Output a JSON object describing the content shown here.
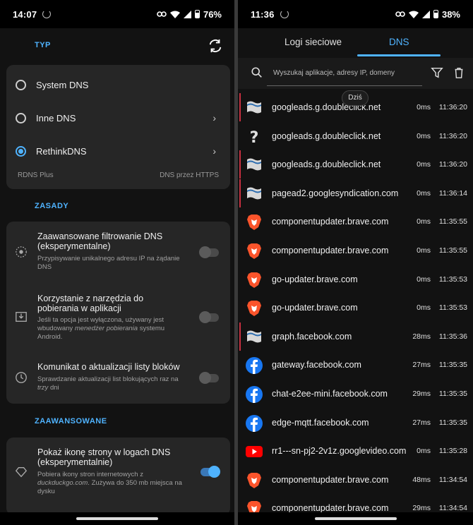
{
  "left": {
    "status": {
      "time": "14:07",
      "battery": "76%"
    },
    "section_type": "TYP",
    "dns_options": [
      {
        "label": "System DNS",
        "selected": false,
        "has_chevron": false
      },
      {
        "label": "Inne DNS",
        "selected": false,
        "has_chevron": true
      },
      {
        "label": "RethinkDNS",
        "selected": true,
        "has_chevron": true
      }
    ],
    "dns_footer_left": "RDNS Plus",
    "dns_footer_right": "DNS przez HTTPS",
    "section_rules": "ZASADY",
    "rules": [
      {
        "title": "Zaawansowane filtrowanie DNS (eksperymentalne)",
        "desc": "Przypisywanie unikalnego adresu IP na żądanie DNS",
        "icon": "target-icon",
        "on": false
      },
      {
        "title": "Korzystanie z narzędzia do pobierania w aplikacji",
        "desc_parts": [
          "Jeśli ta opcja jest wyłączona, używany jest wbudowany ",
          "menedżer pobierania",
          " systemu Android."
        ],
        "icon": "download-icon",
        "on": false
      },
      {
        "title": "Komunikat o aktualizacji listy bloków",
        "desc_parts": [
          "Sprawdzanie aktualizacji list blokujących raz na ",
          "trzy",
          " dni"
        ],
        "icon": "clock-icon",
        "on": false
      }
    ],
    "section_advanced": "ZAAWANSOWANE",
    "advanced": [
      {
        "title": "Pokaż ikonę strony w logach DNS (eksperymentalnie)",
        "desc_parts": [
          "Pobiera ikony stron internetowych z ",
          "duckduckgo.com",
          ". Zużywa do 350 mb miejsca na dysku"
        ],
        "icon": "tag-icon",
        "on": true
      }
    ]
  },
  "right": {
    "status": {
      "time": "11:36",
      "battery": "38%"
    },
    "tabs": [
      "Logi sieciowe",
      "DNS"
    ],
    "active_tab": 1,
    "search_placeholder": "Wyszukaj aplikacje, adresy IP, domeny",
    "today_label": "Dziś",
    "logs": [
      {
        "domain": "googleads.g.doubleclick.net",
        "ms": "0ms",
        "time": "11:36:20",
        "icon": "flag-icon",
        "blocked": true
      },
      {
        "domain": "googleads.g.doubleclick.net",
        "ms": "0ms",
        "time": "11:36:20",
        "icon": "question-icon",
        "blocked": false
      },
      {
        "domain": "googleads.g.doubleclick.net",
        "ms": "0ms",
        "time": "11:36:20",
        "icon": "flag-icon",
        "blocked": true
      },
      {
        "domain": "pagead2.googlesyndication.com",
        "ms": "0ms",
        "time": "11:36:14",
        "icon": "flag-icon",
        "blocked": true
      },
      {
        "domain": "componentupdater.brave.com",
        "ms": "0ms",
        "time": "11:35:55",
        "icon": "brave-icon",
        "blocked": false
      },
      {
        "domain": "componentupdater.brave.com",
        "ms": "0ms",
        "time": "11:35:55",
        "icon": "brave-icon",
        "blocked": false
      },
      {
        "domain": "go-updater.brave.com",
        "ms": "0ms",
        "time": "11:35:53",
        "icon": "brave-icon",
        "blocked": false
      },
      {
        "domain": "go-updater.brave.com",
        "ms": "0ms",
        "time": "11:35:53",
        "icon": "brave-icon",
        "blocked": false
      },
      {
        "domain": "graph.facebook.com",
        "ms": "28ms",
        "time": "11:35:36",
        "icon": "flag-icon",
        "blocked": true
      },
      {
        "domain": "gateway.facebook.com",
        "ms": "27ms",
        "time": "11:35:35",
        "icon": "facebook-icon",
        "blocked": false
      },
      {
        "domain": "chat-e2ee-mini.facebook.com",
        "ms": "29ms",
        "time": "11:35:35",
        "icon": "facebook-icon",
        "blocked": false
      },
      {
        "domain": "edge-mqtt.facebook.com",
        "ms": "27ms",
        "time": "11:35:35",
        "icon": "facebook-icon",
        "blocked": false
      },
      {
        "domain": "rr1---sn-pj2-2v1z.googlevideo.com",
        "ms": "0ms",
        "time": "11:35:28",
        "icon": "youtube-icon",
        "blocked": false
      },
      {
        "domain": "componentupdater.brave.com",
        "ms": "48ms",
        "time": "11:34:54",
        "icon": "brave-icon",
        "blocked": false
      },
      {
        "domain": "componentupdater.brave.com",
        "ms": "29ms",
        "time": "11:34:54",
        "icon": "brave-icon",
        "blocked": false
      }
    ]
  },
  "colors": {
    "accent": "#4fb3ff",
    "blocked": "#c73040",
    "facebook": "#1877f2",
    "brave": "#fb542b",
    "youtube": "#ff0000"
  }
}
